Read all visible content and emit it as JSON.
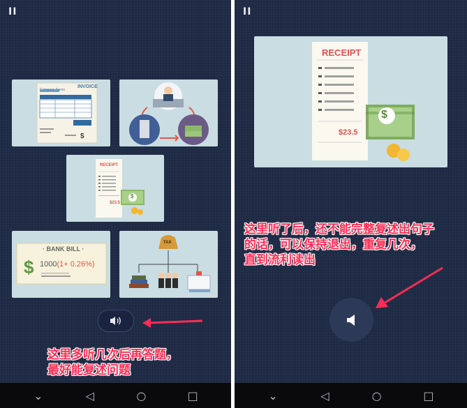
{
  "left_screen": {
    "pause_label": "II",
    "cards": {
      "invoice": {
        "header": "INVOICE",
        "company": "Company Name",
        "price": "$"
      },
      "receipt": {
        "header": "RECEIPT",
        "amount": "$23.5",
        "bill_symbol": "$"
      },
      "bank_bill": {
        "header": "· BANK BILL ·",
        "amount": "1000",
        "rate": "(1+ 0.26%)",
        "symbol": "$"
      },
      "tax": {
        "label": "TAX"
      }
    },
    "annotation": {
      "lines": [
        "这里多听几次后再答题，",
        "最好能复述问题"
      ]
    }
  },
  "right_screen": {
    "pause_label": "II",
    "receipt": {
      "header": "RECEIPT",
      "amount": "$23.5",
      "bill_symbol": "$"
    },
    "annotation": {
      "lines": [
        "这里听了后，还不能完整复述出句子",
        "的话，可以保持退出，重复几次，",
        "直到流利读出"
      ]
    }
  },
  "nav": {
    "back": "◁",
    "home": "○",
    "recents": "□",
    "down": "⌄"
  },
  "colors": {
    "background": "#1e2a44",
    "card": "#c9dde3",
    "annotation": "#ff2d55",
    "bill_green": "#8ab86a",
    "receipt_red": "#d9534f"
  },
  "icons": [
    "pause-icon",
    "speaker-icon",
    "arrow-icon",
    "back-icon",
    "home-icon",
    "recents-icon",
    "chevron-down-icon"
  ]
}
